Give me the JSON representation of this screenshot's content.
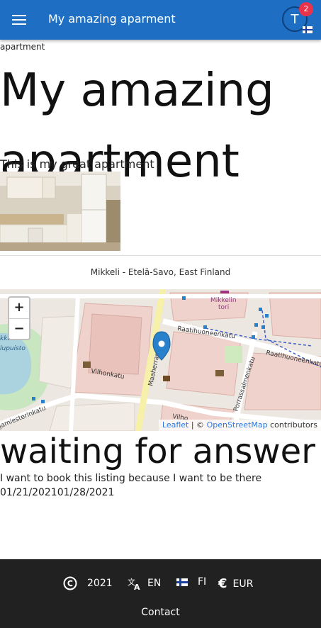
{
  "header": {
    "title": "My amazing aparment",
    "avatar_initial": "T",
    "notification_count": "2"
  },
  "breadcrumb": "apartment",
  "listing": {
    "title": "My amazing apartment",
    "description": "This is my great apartment",
    "location": "Mikkeli - Etelä-Savo, East Finland",
    "status": "waiting for answer",
    "message": "I want to book this listing because I want to be there",
    "dates": "01/21/202101/28/2021"
  },
  "map": {
    "zoom_in": "+",
    "zoom_out": "−",
    "attribution_leaflet": "Leaflet",
    "attribution_sep": "| ©",
    "attribution_osm": "OpenStreetMap",
    "attribution_suffix": "contributors",
    "labels": {
      "tori1": "Mikkelin",
      "tori2": "tori",
      "street1": "Raatihuoneenkatu",
      "street2": "Raatihuoneenkatu",
      "street3": "Maaherrankatu",
      "street4": "Porrassalmenkatu",
      "street5": "Vilhonkatu",
      "street6": "Vilho",
      "street7": "lupuisto",
      "street8": "jamiesterinkatu",
      "street9": "kkuli"
    }
  },
  "footer": {
    "copyright_year": "2021",
    "lang_en": "EN",
    "lang_fi": "FI",
    "currency": "EUR",
    "contact": "Contact"
  },
  "colors": {
    "header_bg": "#1e6fc4",
    "badge": "#e8334a",
    "footer_bg": "#212121",
    "marker": "#2a81cb"
  }
}
